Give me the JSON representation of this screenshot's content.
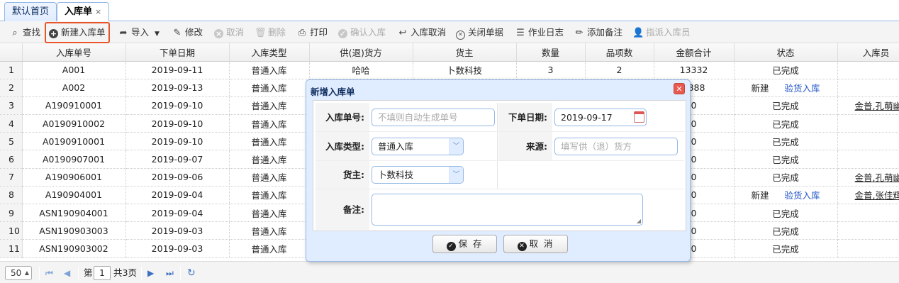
{
  "tabs": [
    {
      "label": "默认首页"
    },
    {
      "label": "入库单",
      "close": "×"
    }
  ],
  "toolbar": {
    "search": "查找",
    "new_inbound": "新建入库单",
    "import": "导入",
    "edit": "修改",
    "cancel": "取消",
    "delete": "删除",
    "print": "打印",
    "confirm_inbound": "确认入库",
    "inbound_cancel": "入库取消",
    "close_doc": "关闭单据",
    "work_log": "作业日志",
    "add_note": "添加备注",
    "assign_staff": "指派入库员"
  },
  "grid": {
    "columns": [
      "入库单号",
      "下单日期",
      "入库类型",
      "供(退)货方",
      "货主",
      "数量",
      "品项数",
      "金额合计",
      "状态",
      "入库员"
    ],
    "rows": [
      {
        "n": "1",
        "no": "A001",
        "date": "2019-09-11",
        "type": "普通入库",
        "supplier": "哈哈",
        "owner": "卜数科技",
        "qty": "3",
        "items": "2",
        "amount": "13332",
        "status": "已完成",
        "status_link": "",
        "staff": ""
      },
      {
        "n": "2",
        "no": "A002",
        "date": "2019-09-13",
        "type": "普通入库",
        "supplier": "",
        "owner": "",
        "qty": "",
        "items": "",
        "amount": "0888",
        "status": "新建",
        "status_link": "验货入库",
        "staff": ""
      },
      {
        "n": "3",
        "no": "A190910001",
        "date": "2019-09-10",
        "type": "普通入库",
        "supplier": "",
        "owner": "",
        "qty": "",
        "items": "",
        "amount": "0",
        "status": "已完成",
        "status_link": "",
        "staff": "金普,孔萌幽"
      },
      {
        "n": "4",
        "no": "A0190910002",
        "date": "2019-09-10",
        "type": "普通入库",
        "supplier": "",
        "owner": "",
        "qty": "",
        "items": "",
        "amount": "0",
        "status": "已完成",
        "status_link": "",
        "staff": ""
      },
      {
        "n": "5",
        "no": "A0190910001",
        "date": "2019-09-10",
        "type": "普通入库",
        "supplier": "",
        "owner": "",
        "qty": "",
        "items": "",
        "amount": "0",
        "status": "已完成",
        "status_link": "",
        "staff": ""
      },
      {
        "n": "6",
        "no": "A0190907001",
        "date": "2019-09-07",
        "type": "普通入库",
        "supplier": "",
        "owner": "",
        "qty": "",
        "items": "",
        "amount": "0",
        "status": "已完成",
        "status_link": "",
        "staff": ""
      },
      {
        "n": "7",
        "no": "A190906001",
        "date": "2019-09-06",
        "type": "普通入库",
        "supplier": "",
        "owner": "",
        "qty": "",
        "items": "",
        "amount": "0",
        "status": "已完成",
        "status_link": "",
        "staff": "金普,孔萌幽"
      },
      {
        "n": "8",
        "no": "A190904001",
        "date": "2019-09-04",
        "type": "普通入库",
        "supplier": "",
        "owner": "",
        "qty": "",
        "items": "",
        "amount": "0",
        "status": "新建",
        "status_link": "验货入库",
        "staff": "金普,张佳辉"
      },
      {
        "n": "9",
        "no": "ASN190904001",
        "date": "2019-09-04",
        "type": "普通入库",
        "supplier": "",
        "owner": "",
        "qty": "",
        "items": "",
        "amount": "0",
        "status": "已完成",
        "status_link": "",
        "staff": ""
      },
      {
        "n": "10",
        "no": "ASN190903003",
        "date": "2019-09-03",
        "type": "普通入库",
        "supplier": "",
        "owner": "",
        "qty": "",
        "items": "",
        "amount": "0",
        "status": "已完成",
        "status_link": "",
        "staff": ""
      },
      {
        "n": "11",
        "no": "ASN190903002",
        "date": "2019-09-03",
        "type": "普通入库",
        "supplier": "",
        "owner": "",
        "qty": "",
        "items": "",
        "amount": "0",
        "status": "已完成",
        "status_link": "",
        "staff": ""
      }
    ]
  },
  "pager": {
    "page_size": "50",
    "page_prefix": "第",
    "page_value": "1",
    "page_total": "共3页"
  },
  "dialog": {
    "title": "新增入库单",
    "close": "✕",
    "order_no_label": "入库单号:",
    "order_no_placeholder": "不填则自动生成单号",
    "order_date_label": "下单日期:",
    "order_date_value": "2019-09-17",
    "type_label": "入库类型:",
    "type_value": "普通入库",
    "source_label": "来源:",
    "source_placeholder": "填写供（退）货方",
    "owner_label": "货主:",
    "owner_value": "卜数科技",
    "note_label": "备注:",
    "save": "保 存",
    "cancel": "取 消"
  }
}
